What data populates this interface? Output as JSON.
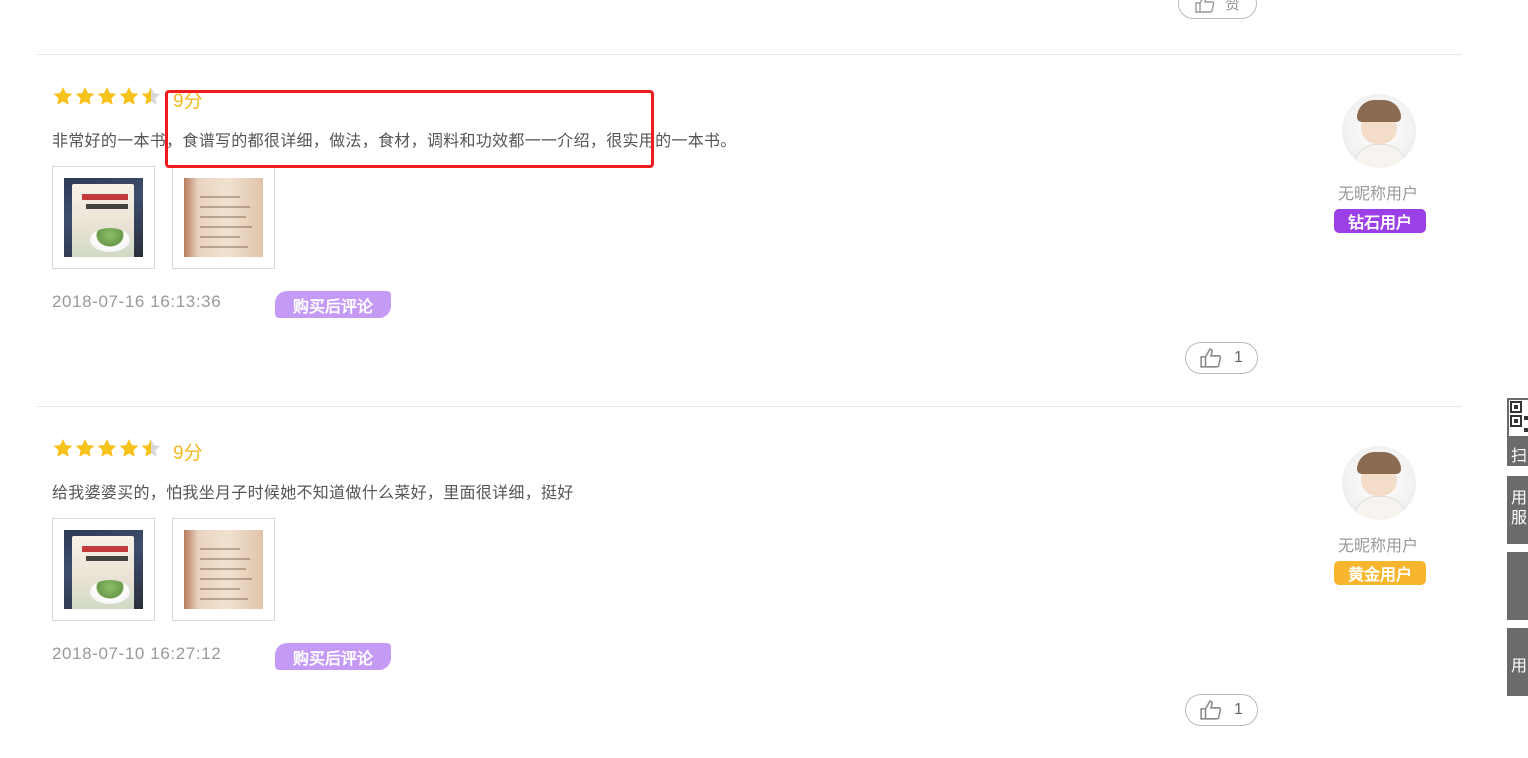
{
  "top_like": {
    "label": "赞"
  },
  "reviews": [
    {
      "rating_stars": 4.5,
      "score": "9分",
      "content": "非常好的一本书，食谱写的都很详细，做法，食材，调料和功效都一一介绍，很实用的一本书。",
      "images": [
        "book-cover-thumbnail",
        "book-page-thumbnail"
      ],
      "date": "2018-07-16 16:13:36",
      "badge": "购买后评论",
      "likes": "1",
      "user": {
        "nickname": "无昵称用户",
        "level": "钻石用户",
        "level_color": "#9b3fe6"
      }
    },
    {
      "rating_stars": 4.5,
      "score": "9分",
      "content": "给我婆婆买的，怕我坐月子时候她不知道做什么菜好，里面很详细，挺好",
      "images": [
        "book-cover-thumbnail",
        "book-page-thumbnail"
      ],
      "date": "2018-07-10 16:27:12",
      "badge": "购买后评论",
      "likes": "1",
      "user": {
        "nickname": "无昵称用户",
        "level": "黄金用户",
        "level_color": "#f7b62d"
      }
    }
  ],
  "side_tabs": [
    "扫",
    "用 服",
    "",
    "用"
  ],
  "colors": {
    "star": "#f7c21b",
    "score": "#f5b825",
    "badge": "#c59af5",
    "highlight": "#ee1c1c"
  }
}
